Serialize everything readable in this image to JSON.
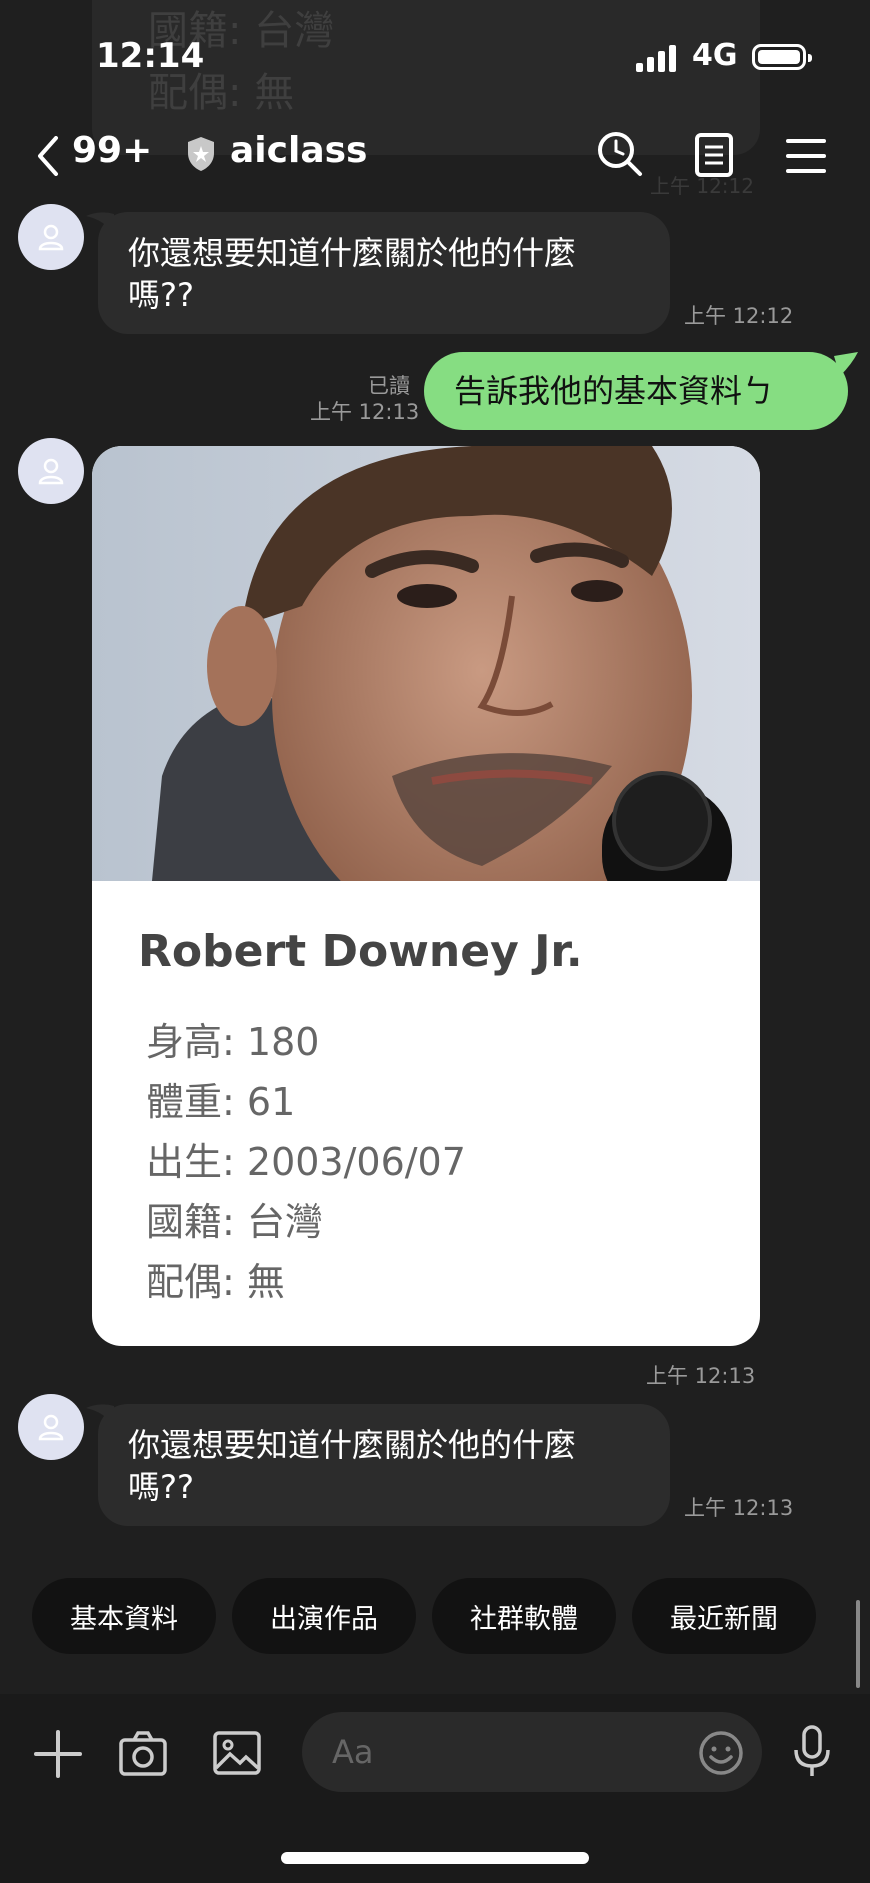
{
  "ghost_card": {
    "line1": "國籍: 台灣",
    "line2": "配偶: 無",
    "time": "上午 12:12"
  },
  "status_bar": {
    "time": "12:14",
    "network": "4G"
  },
  "nav": {
    "unread_count": "99+",
    "room_name": "aiclass"
  },
  "messages": [
    {
      "text_line1": "你還想要知道什麼關於他的什麼",
      "text_line2": "嗎??",
      "time": "上午 12:12"
    },
    {
      "text": "告訴我他的基本資料ㄅ",
      "read": "已讀",
      "time": "上午 12:13"
    }
  ],
  "profile_card": {
    "name": "Robert Downey Jr.",
    "rows": [
      {
        "label": "身高: ",
        "value": "180"
      },
      {
        "label": "體重: ",
        "value": "61"
      },
      {
        "label": "出生: ",
        "value": "2003/06/07"
      },
      {
        "label": "國籍: ",
        "value": "台灣"
      },
      {
        "label": "配偶: ",
        "value": "無"
      }
    ],
    "time": "上午 12:13"
  },
  "last_message": {
    "text_line1": "你還想要知道什麼關於他的什麼",
    "text_line2": "嗎??",
    "time": "上午 12:13"
  },
  "quick_replies": [
    "基本資料",
    "出演作品",
    "社群軟體",
    "最近新聞"
  ],
  "input": {
    "placeholder": "Aa"
  },
  "colors": {
    "background": "#1f1f1f",
    "bubble_received": "#2c2c2c",
    "bubble_sent": "#86dd82",
    "quick_reply_bg": "#121212"
  }
}
